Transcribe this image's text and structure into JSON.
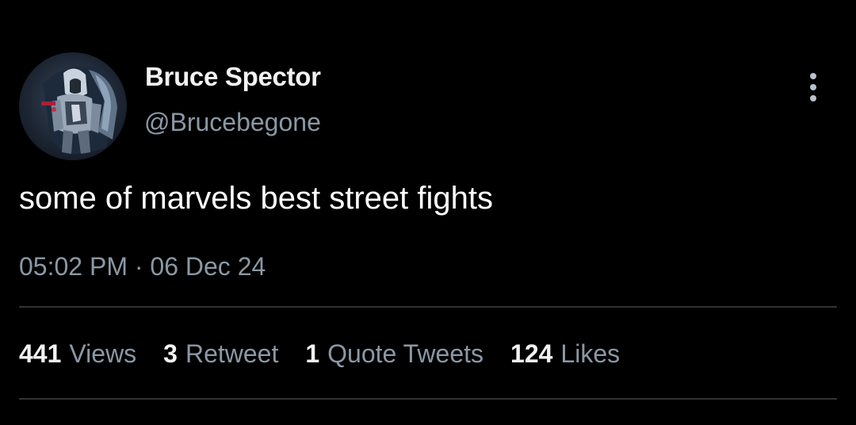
{
  "author": {
    "display_name": "Bruce Spector",
    "handle": "@Brucebegone",
    "avatar_icon": "hooded-knight-avatar"
  },
  "tweet": {
    "text": "some of marvels best street fights",
    "time": "05:02 PM",
    "separator": "·",
    "date": "06 Dec 24"
  },
  "stats": [
    {
      "count": "441",
      "label": "Views"
    },
    {
      "count": "3",
      "label": "Retweet"
    },
    {
      "count": "1",
      "label": "Quote Tweets"
    },
    {
      "count": "124",
      "label": "Likes"
    }
  ],
  "menu": {
    "icon": "more-vertical-icon"
  },
  "colors": {
    "background": "#000000",
    "primary_text": "#ffffff",
    "secondary_text": "#8b98a5",
    "divider": "#2f3336"
  }
}
